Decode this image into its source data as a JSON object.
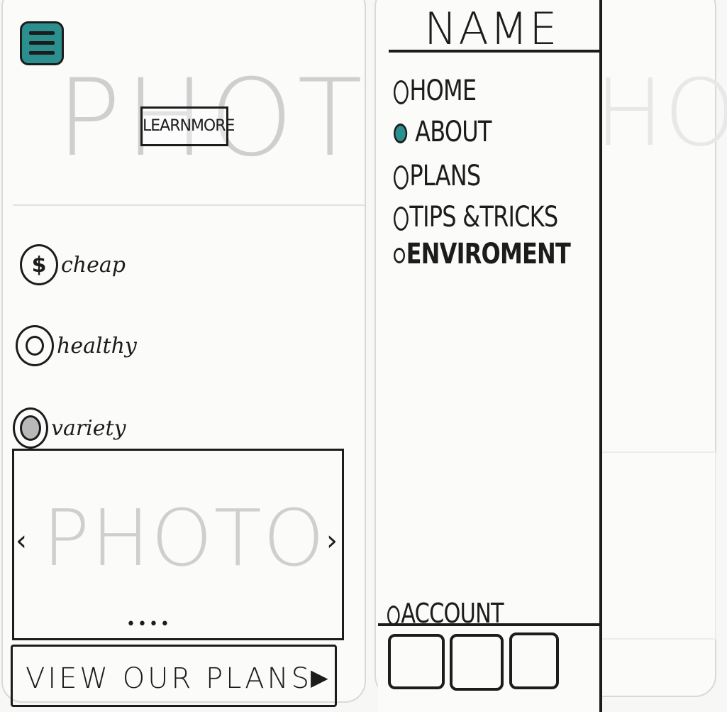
{
  "left_screen": {
    "hero": {
      "photo_placeholder": "PHOTO",
      "learn_more_label": "LEARNMORE"
    },
    "features": [
      {
        "icon": "dollar-icon",
        "glyph": "$",
        "label": "cheap"
      },
      {
        "icon": "apple-icon",
        "glyph": "",
        "label": "healthy"
      },
      {
        "icon": "food-icon",
        "glyph": "",
        "label": "variety"
      }
    ],
    "carousel": {
      "photo_placeholder": "PHOTO",
      "prev_glyph": "‹",
      "next_glyph": "›",
      "dots": "••••"
    },
    "cta_label": "VIEW OUR PLANS-",
    "cta_arrow": "▶"
  },
  "right_screen": {
    "title": "NAME",
    "nav_items": [
      {
        "label": "HOME",
        "selected": false
      },
      {
        "label": "ABOUT",
        "selected": true
      },
      {
        "label": "PLANS",
        "selected": false
      },
      {
        "label": "TIPS &TRICKS",
        "selected": false
      },
      {
        "label": "ENVIROMENT",
        "selected": false
      }
    ],
    "account_label": "ACCOUNT",
    "background_photo_placeholder": "PHOTO",
    "tab_count": 3
  },
  "colors": {
    "accent": "#2b8f8f",
    "ink": "#1c1c1c",
    "pencil": "#cfcfcf",
    "paper": "#f7f7f6"
  }
}
